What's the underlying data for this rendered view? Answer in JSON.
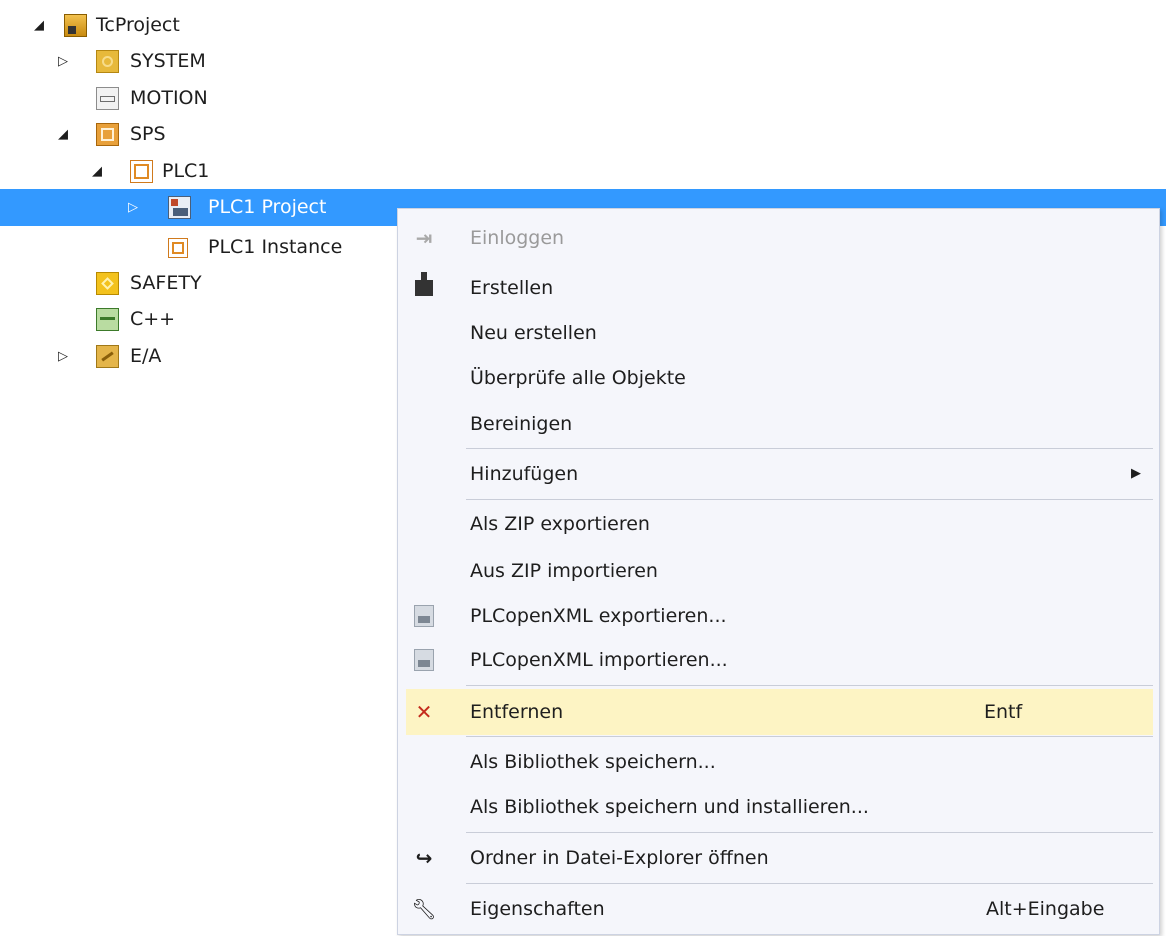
{
  "tree": {
    "project": "TcProject",
    "system": "SYSTEM",
    "motion": "MOTION",
    "sps": "SPS",
    "plc1": "PLC1",
    "plc1_project": "PLC1 Project",
    "plc1_instance": "PLC1 Instance",
    "safety": "SAFETY",
    "cpp": "C++",
    "ea": "E/A"
  },
  "glyphs": {
    "expanded": "◢",
    "collapsed": "▷",
    "submenu": "▶"
  },
  "context_menu": {
    "login": "Einloggen",
    "build": "Erstellen",
    "rebuild": "Neu erstellen",
    "check_all": "Überprüfe alle Objekte",
    "clean": "Bereinigen",
    "add": "Hinzufügen",
    "export_zip": "Als ZIP exportieren",
    "import_zip": "Aus ZIP importieren",
    "export_plcopen": "PLCopenXML exportieren...",
    "import_plcopen": "PLCopenXML importieren...",
    "remove": "Entfernen",
    "remove_shortcut": "Entf",
    "save_library": "Als Bibliothek speichern...",
    "save_install_library": "Als Bibliothek speichern und installieren...",
    "open_folder": "Ordner in Datei-Explorer öffnen",
    "properties": "Eigenschaften",
    "properties_shortcut": "Alt+Eingabe"
  },
  "icons": {
    "project": "project-icon",
    "system": "system-icon",
    "motion": "motion-icon",
    "sps": "plc-icon",
    "plc1": "plc-icon",
    "plc1_project": "plc-project-icon",
    "plc1_instance": "plc-instance-icon",
    "safety": "safety-icon",
    "cpp": "cpp-icon",
    "ea": "io-icon",
    "login": "login-icon",
    "build": "build-icon",
    "plcopen": "xml-icon",
    "remove": "delete-x-icon",
    "open_folder": "redo-arrow-icon",
    "properties": "wrench-icon"
  },
  "colors": {
    "selection": "#3399ff",
    "menu_background": "#f5f6fb",
    "menu_highlight": "#fdf4c4",
    "delete_red": "#c42b1c"
  }
}
